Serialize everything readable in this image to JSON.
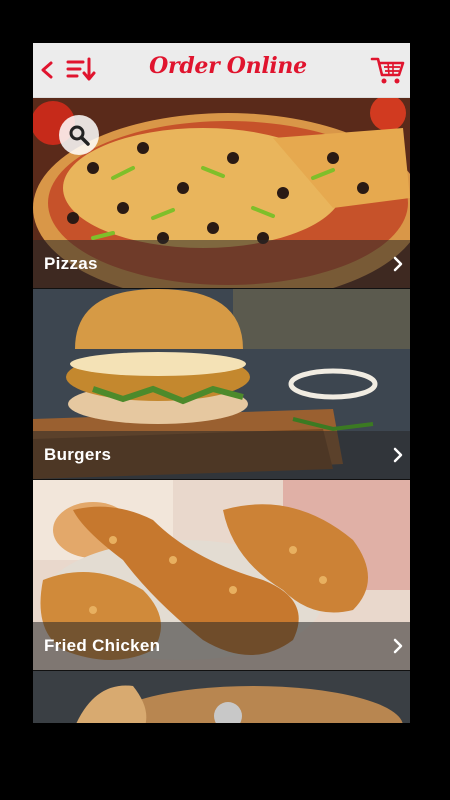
{
  "header": {
    "title": "Order Online",
    "back_icon": "chevron-left-icon",
    "sort_icon": "sort-descending-icon",
    "cart_icon": "shopping-cart-icon"
  },
  "categories": [
    {
      "label": "Pizzas",
      "icon": "chevron-right-icon"
    },
    {
      "label": "Burgers",
      "icon": "chevron-right-icon"
    },
    {
      "label": "Fried Chicken",
      "icon": "chevron-right-icon"
    }
  ],
  "search": {
    "icon": "search-icon"
  },
  "colors": {
    "accent": "#e0142e",
    "header_bg": "#ececec"
  }
}
